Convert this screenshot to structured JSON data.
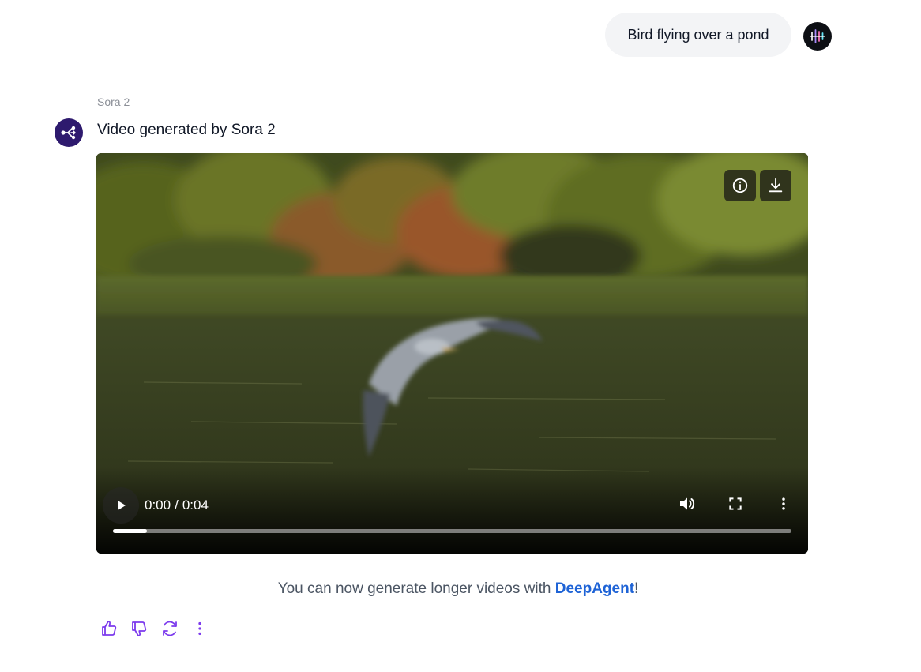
{
  "user_message": {
    "text": "Bird flying over a pond",
    "avatar_icon": "equalizer-bars-icon"
  },
  "assistant": {
    "model_name": "Sora 2",
    "avatar_icon": "share-nodes-icon",
    "response_title": "Video generated by Sora 2"
  },
  "video": {
    "current_time": "0:00",
    "separator": "/",
    "duration": "0:04",
    "progress": 0.05,
    "overlay_buttons": [
      "info-icon",
      "download-icon"
    ],
    "controls": [
      "play-icon",
      "volume-icon",
      "fullscreen-icon",
      "more-options-icon"
    ]
  },
  "promo": {
    "prefix": "You can now generate longer videos with ",
    "link": "DeepAgent",
    "suffix": "!"
  },
  "actions": [
    "thumbs-up-icon",
    "thumbs-down-icon",
    "regenerate-icon",
    "more-vertical-icon"
  ],
  "colors": {
    "accent": "#7c3aed",
    "link": "#1e63d6",
    "bot_avatar": "#2e1a6e"
  }
}
